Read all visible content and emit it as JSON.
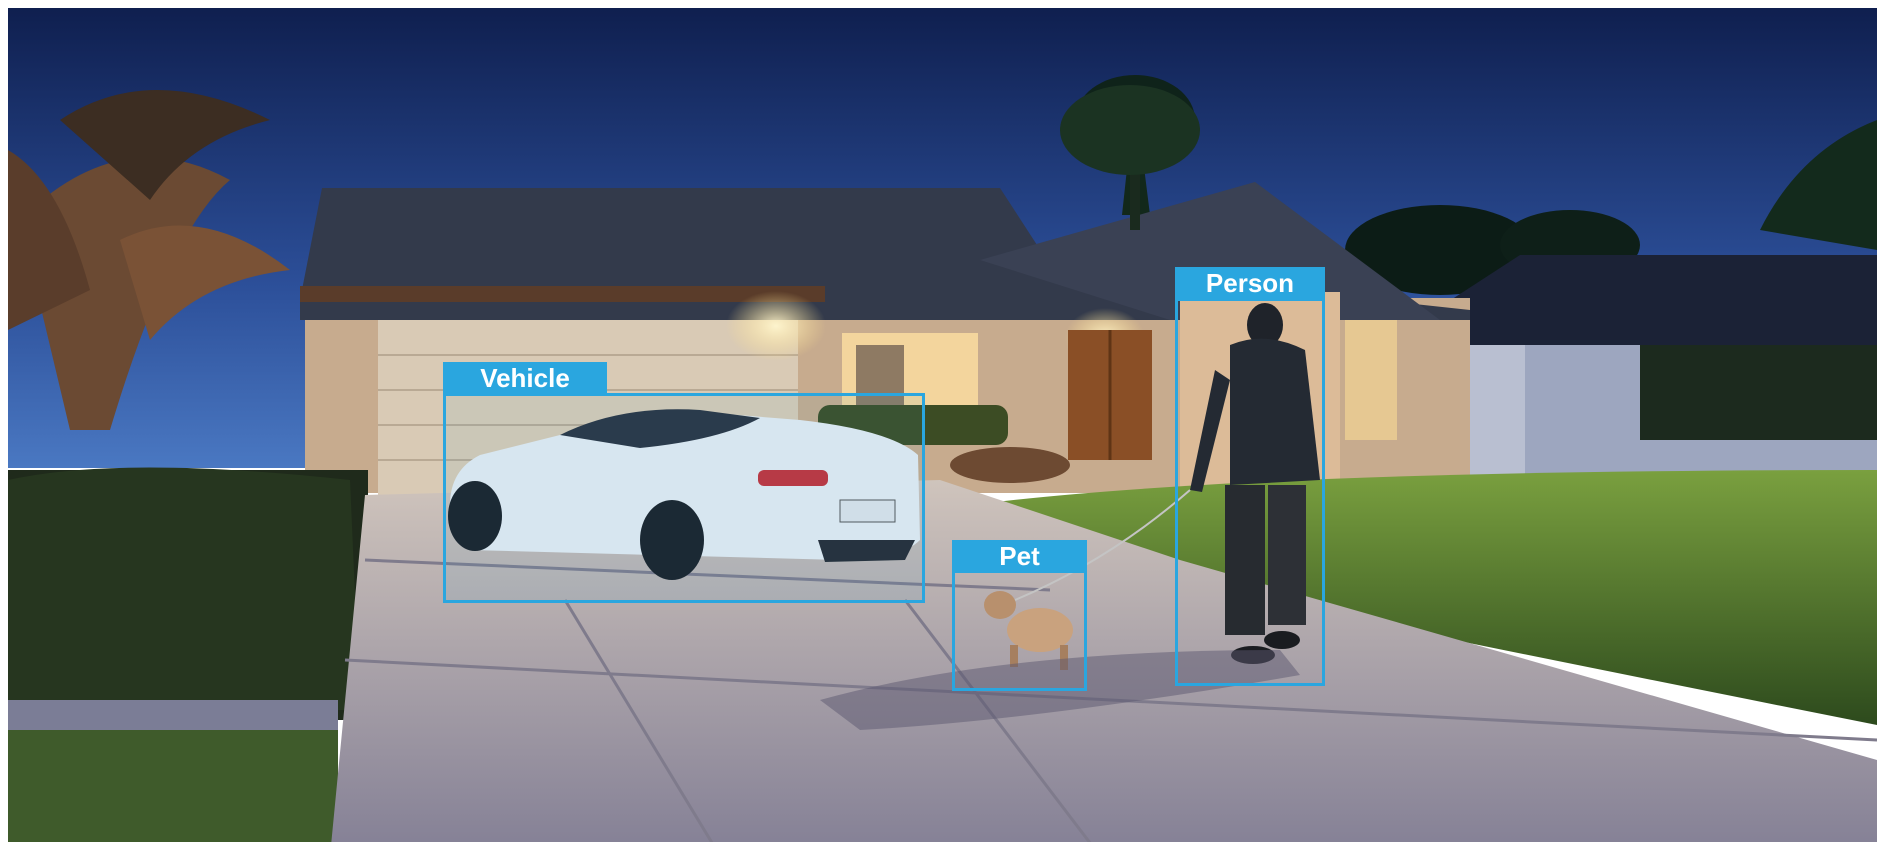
{
  "detections": [
    {
      "label": "Vehicle"
    },
    {
      "label": "Pet"
    },
    {
      "label": "Person"
    }
  ],
  "colors": {
    "box_accent": "#2aa6df",
    "label_text": "#ffffff",
    "sky_top": "#0f1f4f",
    "sky_bottom": "#4a78c2",
    "lawn": "#4e7a2c",
    "driveway": "#a5a3b1"
  }
}
